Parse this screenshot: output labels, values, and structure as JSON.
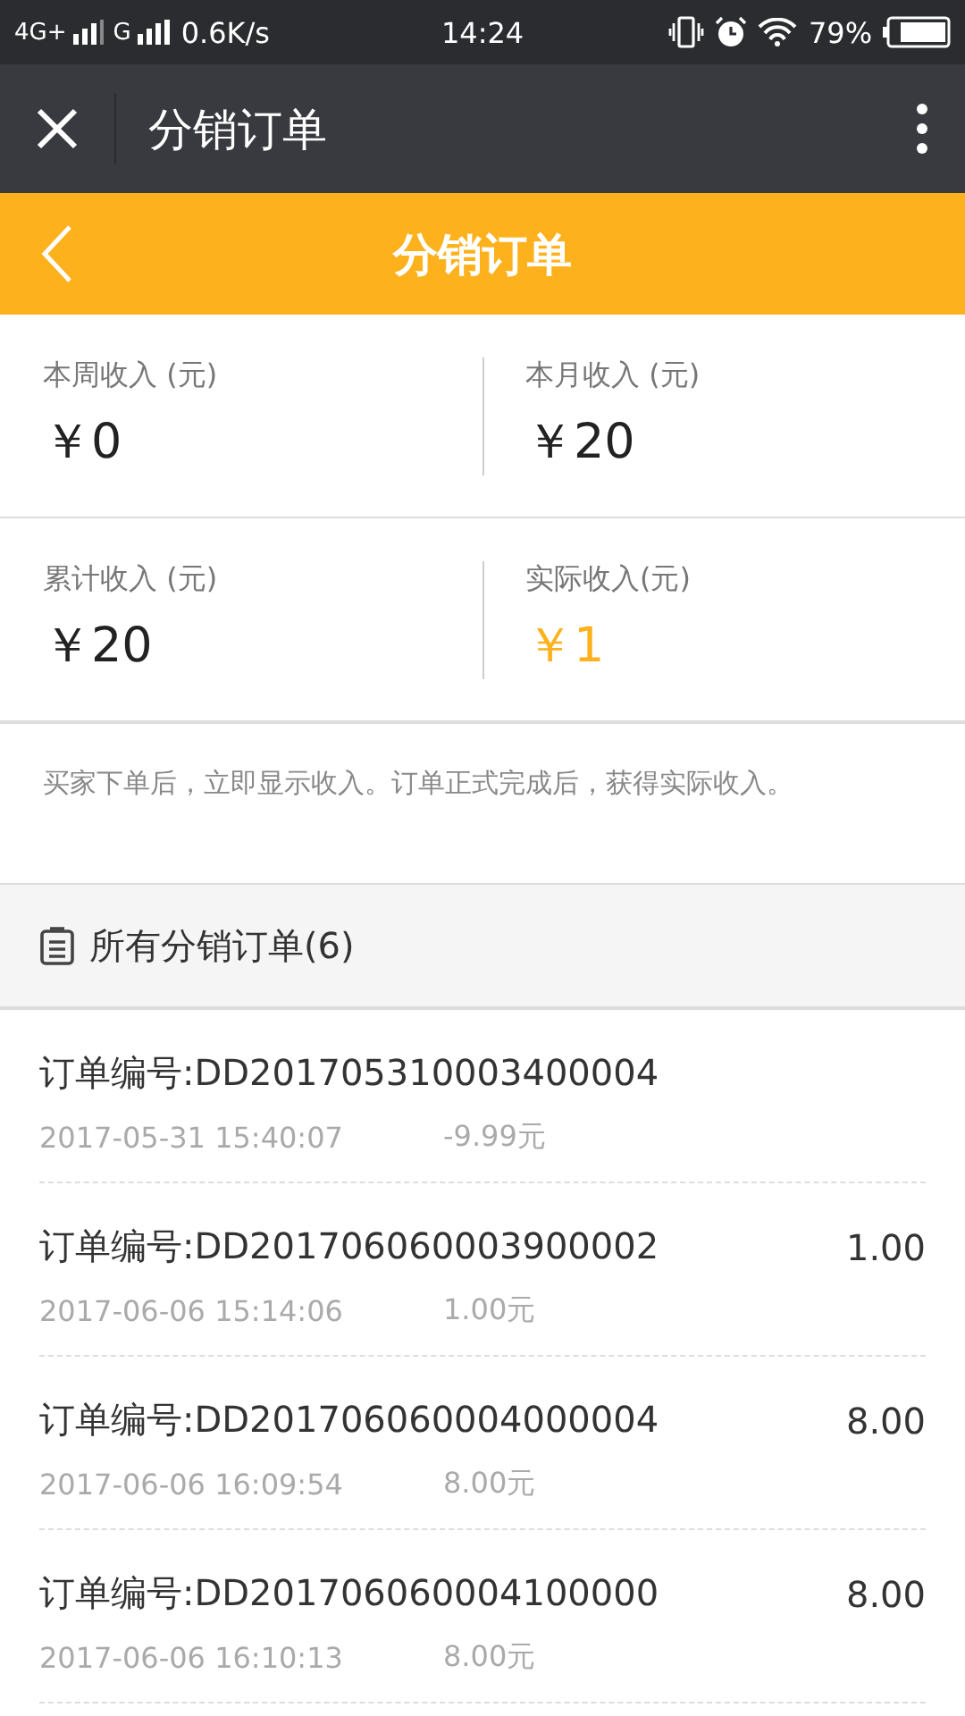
{
  "status_bar": {
    "network_1": "4G+",
    "network_2": "G",
    "speed": "0.6K/s",
    "time": "14:24",
    "battery": "79%"
  },
  "app_bar": {
    "title": "分销订单"
  },
  "header": {
    "title": "分销订单"
  },
  "stats": [
    {
      "label": "本周收入 (元)",
      "value": "￥0",
      "highlight": false
    },
    {
      "label": "本月收入 (元)",
      "value": "￥20",
      "highlight": false
    },
    {
      "label": "累计收入 (元)",
      "value": "￥20",
      "highlight": false
    },
    {
      "label": "实际收入(元)",
      "value": "￥1",
      "highlight": true
    }
  ],
  "note": "买家下单后，立即显示收入。订单正式完成后，获得实际收入。",
  "section": {
    "title": "所有分销订单(6)"
  },
  "orders": [
    {
      "number": "订单编号:DD201705310003400004",
      "time": "2017-05-31 15:40:07",
      "commission": "-9.99元"
    },
    {
      "number": "订单编号:DD201706060003900002",
      "amount": "1.00",
      "time": "2017-06-06 15:14:06",
      "commission": "1.00元"
    },
    {
      "number": "订单编号:DD201706060004000004",
      "amount": "8.00",
      "time": "2017-06-06 16:09:54",
      "commission": "8.00元"
    },
    {
      "number": "订单编号:DD201706060004100000",
      "amount": "8.00",
      "time": "2017-06-06 16:10:13",
      "commission": "8.00元"
    }
  ]
}
